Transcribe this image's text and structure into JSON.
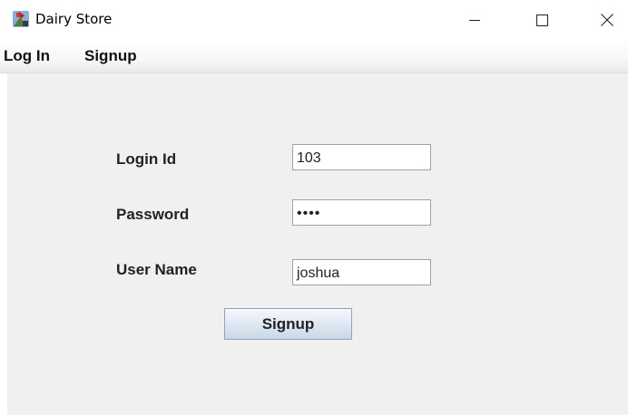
{
  "window": {
    "title": "Dairy Store",
    "controls": {
      "minimize": "minimize-icon",
      "maximize": "maximize-icon",
      "close": "close-icon"
    }
  },
  "menu": {
    "items": [
      {
        "label": "Log In"
      },
      {
        "label": "Signup"
      }
    ]
  },
  "form": {
    "login_id": {
      "label": "Login Id",
      "value": "103"
    },
    "password": {
      "label": "Password",
      "value": "••••"
    },
    "user_name": {
      "label": "User Name",
      "value": "joshua"
    },
    "submit_label": "Signup"
  },
  "colors": {
    "content_background": "#f0f0f0",
    "button_gradient_top": "#f6f9fc",
    "button_gradient_bottom": "#c9d7e6",
    "button_border": "#8aa4c0"
  }
}
